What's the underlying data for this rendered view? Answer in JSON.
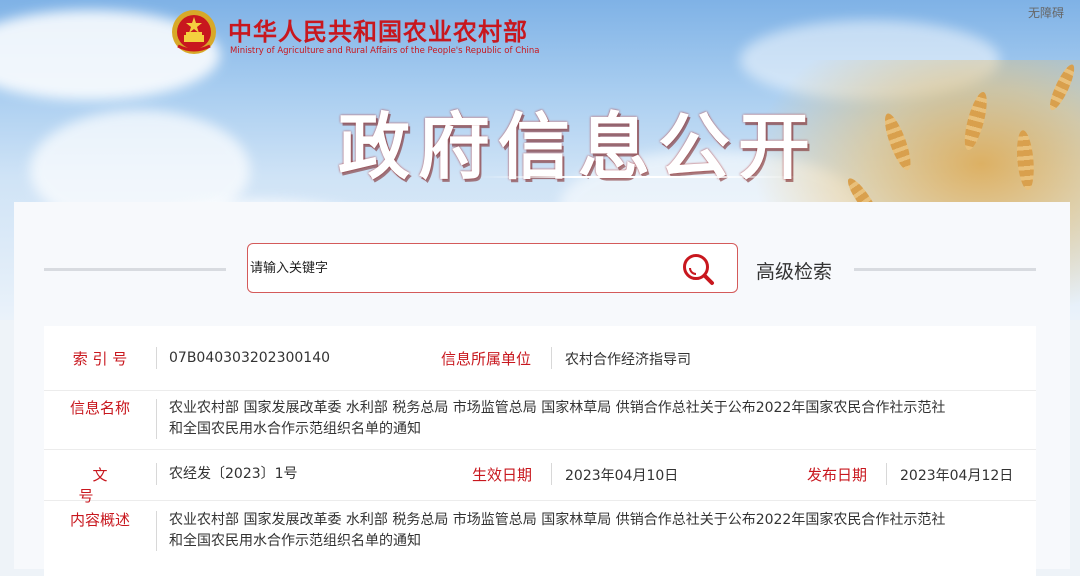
{
  "header": {
    "ministry_name": "中华人民共和国农业农村部",
    "ministry_name_en": "Ministry of Agriculture and Rural Affairs of the People's Republic of China",
    "accessibility": "无障碍",
    "page_title": "政府信息公开"
  },
  "search": {
    "placeholder": "请输入关键字",
    "advanced_label": "高级检索",
    "icon": "search-icon"
  },
  "info": {
    "index_label": "索 引 号",
    "index_value": "07B040303202300140",
    "unit_label": "信息所属单位",
    "unit_value": "农村合作经济指导司",
    "name_label": "信息名称",
    "name_value_line1": "农业农村部 国家发展改革委 水利部 税务总局 市场监管总局 国家林草局 供销合作总社关于公布2022年国家农民合作社示范社",
    "name_value_line2": "和全国农民用水合作示范组织名单的通知",
    "doc_label": "文号",
    "doc_value": "农经发〔2023〕1号",
    "effective_label": "生效日期",
    "effective_value": "2023年04月10日",
    "publish_label": "发布日期",
    "publish_value": "2023年04月12日",
    "summary_label": "内容概述",
    "summary_value_line1": "农业农村部 国家发展改革委 水利部 税务总局 市场监管总局 国家林草局 供销合作总社关于公布2022年国家农民合作社示范社",
    "summary_value_line2": "和全国农民用水合作示范组织名单的通知"
  },
  "colors": {
    "brand_red": "#c8171e",
    "label_red": "#c8171e",
    "search_border": "#d45a5a"
  }
}
